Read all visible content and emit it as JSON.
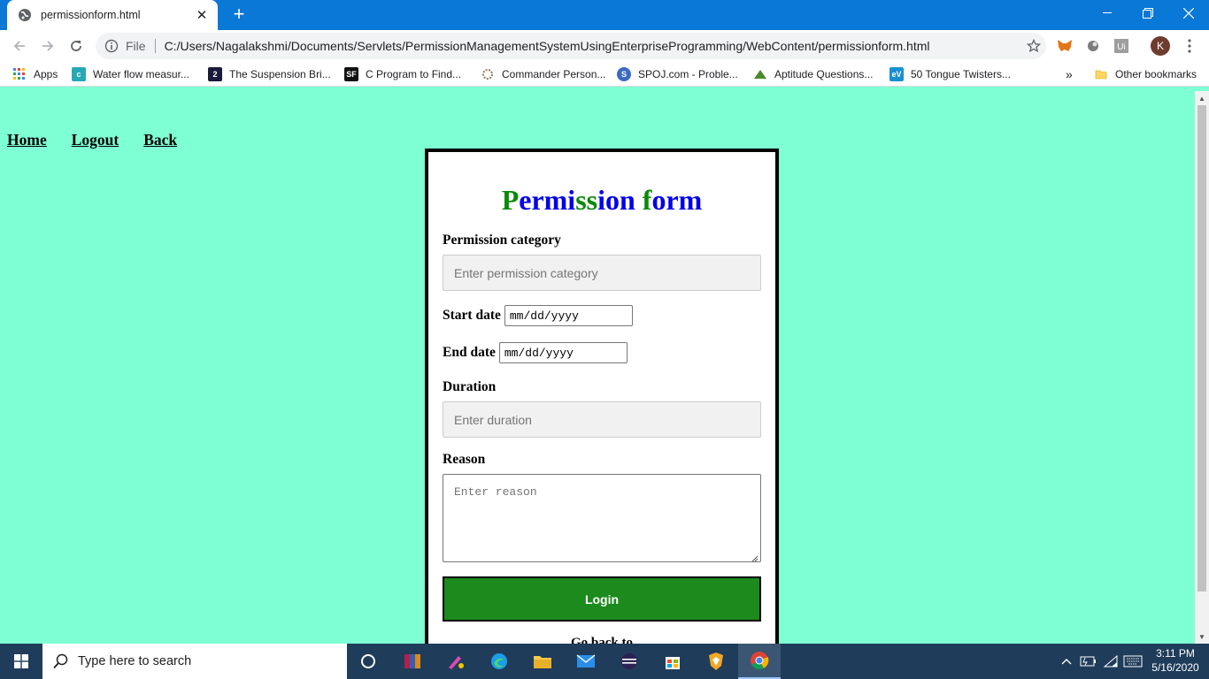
{
  "browser": {
    "tab_title": "permissionform.html",
    "omnibox_scheme": "File",
    "url": "C:/Users/Nagalakshmi/Documents/Servlets/PermissionManagementSystemUsingEnterpriseProgramming/WebContent/permissionform.html",
    "profile_initial": "K",
    "bookmarks": [
      {
        "label": "Apps",
        "icon": "apps-grid-icon"
      },
      {
        "label": "Water flow measur...",
        "icon": "bookmark-favicon"
      },
      {
        "label": "The Suspension Bri...",
        "icon": "bookmark-favicon"
      },
      {
        "label": "C Program to Find...",
        "icon": "bookmark-favicon"
      },
      {
        "label": "Commander Person...",
        "icon": "bookmark-favicon"
      },
      {
        "label": "SPOJ.com - Proble...",
        "icon": "bookmark-favicon"
      },
      {
        "label": "Aptitude Questions...",
        "icon": "bookmark-favicon"
      },
      {
        "label": "50 Tongue Twisters...",
        "icon": "bookmark-favicon"
      }
    ],
    "bookmark_overflow": "»",
    "other_bookmarks": "Other bookmarks"
  },
  "page": {
    "nav": {
      "home": "Home",
      "logout": "Logout",
      "back": "Back"
    },
    "form": {
      "title_parts": [
        {
          "t": "P",
          "c": "g"
        },
        {
          "t": "ermi",
          "c": "b"
        },
        {
          "t": "ss",
          "c": "g"
        },
        {
          "t": "ion",
          "c": "b"
        },
        {
          "t": " f",
          "c": "g"
        },
        {
          "t": "orm",
          "c": "b"
        }
      ],
      "category_label": "Permission category",
      "category_placeholder": "Enter permission category",
      "start_label": "Start date",
      "start_value": "mm/dd/yyyy",
      "end_label": "End date",
      "end_value": "mm/dd/yyyy",
      "duration_label": "Duration",
      "duration_placeholder": "Enter duration",
      "reason_label": "Reason",
      "reason_placeholder": "Enter reason",
      "submit_label": "Login",
      "partial_text": "Go back to"
    }
  },
  "taskbar": {
    "search_placeholder": "Type here to search",
    "time": "3:11 PM",
    "date": "5/16/2020"
  },
  "colors": {
    "page_bg": "#7fffd4",
    "title_green": "#0a8a0a",
    "title_blue": "#0000ee",
    "button_green": "#1d8a1d",
    "taskbar": "#1f3c5a",
    "chrome_blue": "#0a78d7"
  }
}
